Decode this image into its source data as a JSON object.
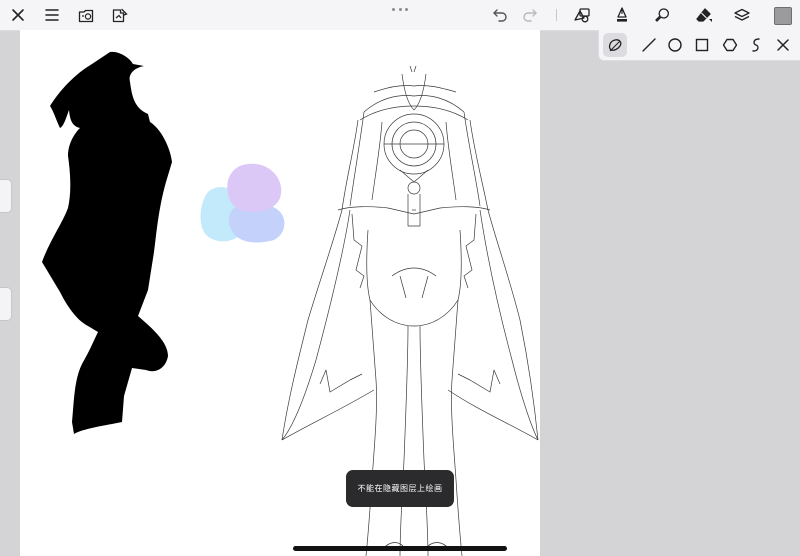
{
  "app": {
    "toolbar_left": [
      {
        "name": "close-icon"
      },
      {
        "name": "menu-icon"
      },
      {
        "name": "gallery-icon"
      },
      {
        "name": "adjust-icon"
      }
    ],
    "toolbar_right": [
      {
        "name": "undo-icon"
      },
      {
        "name": "redo-icon"
      },
      {
        "name": "shape-tool-icon"
      },
      {
        "name": "pen-tool-icon"
      },
      {
        "name": "smudge-tool-icon"
      },
      {
        "name": "eraser-tool-icon"
      },
      {
        "name": "layers-icon"
      }
    ],
    "current_color": "#9b9b9e"
  },
  "shape_panel": {
    "selected_tool": "freeform-shape",
    "tools": [
      {
        "name": "freeform-shape-icon"
      },
      {
        "name": "line-shape-icon"
      },
      {
        "name": "circle-shape-icon"
      },
      {
        "name": "rectangle-shape-icon"
      },
      {
        "name": "polygon-shape-icon"
      },
      {
        "name": "curve-shape-icon"
      },
      {
        "name": "close-panel-icon"
      }
    ]
  },
  "toast": {
    "message": "不能在隐藏图层上绘画"
  },
  "colors": {
    "toolbar_bg": "#f5f5f7",
    "workspace_bg": "#d4d4d6",
    "canvas_bg": "#ffffff",
    "toast_bg": "#2b2b2d",
    "silhouette": "#000000",
    "blob_violet": "#dcc8f7",
    "blob_cyan": "#c3eafa",
    "blob_periwinkle": "#c4d2fb"
  }
}
